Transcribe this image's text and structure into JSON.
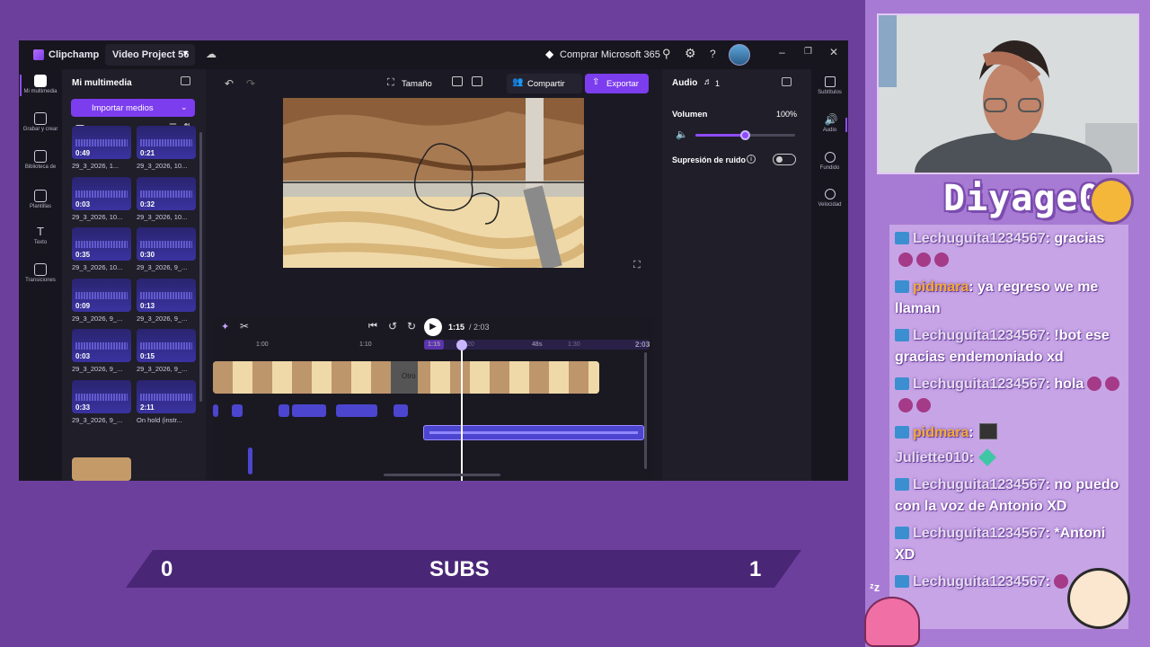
{
  "app": {
    "name": "Clipchamp",
    "project": "Video Project 56",
    "buy_label": "Comprar Microsoft 365"
  },
  "left_rail": [
    {
      "label": "Mi multimedia"
    },
    {
      "label": "Grabar y crear"
    },
    {
      "label": "Biblioteca de"
    },
    {
      "label": "Plantillas"
    },
    {
      "label": "Texto"
    },
    {
      "label": "Transiciones"
    }
  ],
  "media": {
    "title": "Mi multimedia",
    "import_label": "Importar medios",
    "items": [
      {
        "dur": "0:49",
        "name": "29_3_2026, 1..."
      },
      {
        "dur": "0:21",
        "name": "29_3_2026, 10..."
      },
      {
        "dur": "0:03",
        "name": "29_3_2026, 10..."
      },
      {
        "dur": "0:32",
        "name": "29_3_2026, 10..."
      },
      {
        "dur": "0:35",
        "name": "29_3_2026, 10..."
      },
      {
        "dur": "0:30",
        "name": "29_3_2026, 9_..."
      },
      {
        "dur": "0:09",
        "name": "29_3_2026, 9_..."
      },
      {
        "dur": "0:13",
        "name": "29_3_2026, 9_..."
      },
      {
        "dur": "0:03",
        "name": "29_3_2026, 9_..."
      },
      {
        "dur": "0:15",
        "name": "29_3_2026, 9_..."
      },
      {
        "dur": "0:33",
        "name": "29_3_2026, 9_..."
      },
      {
        "dur": "2:11",
        "name": "On hold (instr..."
      }
    ]
  },
  "toolbar": {
    "size_label": "Tamaño",
    "share_label": "Compartir",
    "export_label": "Exportar"
  },
  "player": {
    "current": "1:15",
    "total": "/ 2:03"
  },
  "timeline": {
    "ticks": [
      "1:00",
      "1:10",
      "1:15",
      "20",
      "48s",
      "1:30",
      "2:03"
    ],
    "clip_text": "Otro"
  },
  "audio_panel": {
    "title": "Audio",
    "track_count": "1",
    "volume_label": "Volumen",
    "volume_value": "100%",
    "volume_level": 0.5,
    "noise_label": "Supresión de ruido"
  },
  "right_rail": [
    {
      "label": "Subtítulos"
    },
    {
      "label": "Audio"
    },
    {
      "label": "Fundido"
    },
    {
      "label": "Velocidad"
    }
  ],
  "stream": {
    "channel": "Diyage0",
    "subs_left": "0",
    "subs_label": "SUBS",
    "subs_right": "1"
  },
  "chat": [
    {
      "user": "Lechuguita1234567",
      "text": ": gracias"
    },
    {
      "user": "pidmara",
      "text": ": ya regreso we me llaman"
    },
    {
      "user": "Lechuguita1234567",
      "text": ": !bot ese gracias endemoniado xd"
    },
    {
      "user": "Lechuguita1234567",
      "text": ": hola"
    },
    {
      "user": "pidmara",
      "text": ":"
    },
    {
      "user": "Juliette010",
      "text": ":"
    },
    {
      "user": "Lechuguita1234567",
      "text": ": no puedo con la voz de Antonio XD"
    },
    {
      "user": "Lechuguita1234567",
      "text": ": *Antoni XD"
    },
    {
      "user": "Lechuguita1234567",
      "text": ":"
    }
  ]
}
